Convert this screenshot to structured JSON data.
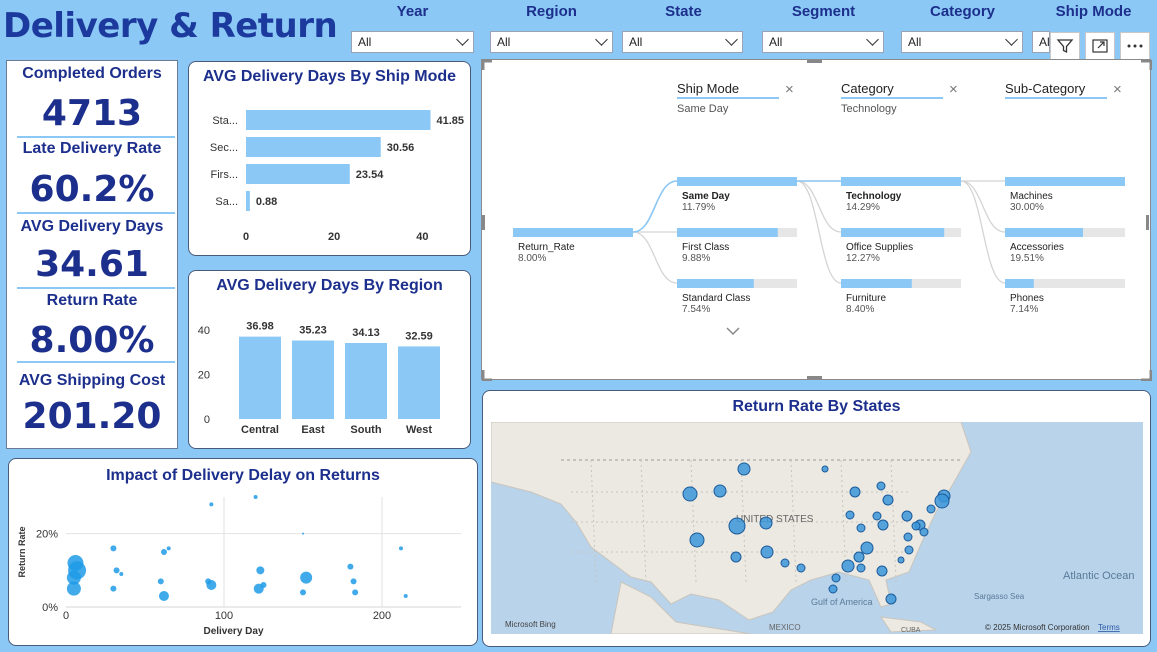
{
  "header": {
    "title": "Delivery & Return"
  },
  "slicers": [
    {
      "label": "Year",
      "value": "All"
    },
    {
      "label": "Region",
      "value": "All"
    },
    {
      "label": "State",
      "value": "All"
    },
    {
      "label": "Segment",
      "value": "All"
    },
    {
      "label": "Category",
      "value": "All"
    },
    {
      "label": "Ship Mode",
      "value": "All"
    }
  ],
  "kpis": [
    {
      "label": "Completed Orders",
      "value": "4713"
    },
    {
      "label": "Late Delivery Rate",
      "value": "60.2%"
    },
    {
      "label": "AVG Delivery Days",
      "value": "34.61"
    },
    {
      "label": "Return Rate",
      "value": "8.00%"
    },
    {
      "label": "AVG Shipping Cost",
      "value": "201.20"
    }
  ],
  "ship_mode_chart": {
    "title": "AVG Delivery Days By Ship Mode",
    "chart_data": {
      "type": "bar",
      "orientation": "horizontal",
      "categories": [
        "Sta...",
        "Sec...",
        "Firs...",
        "Sa..."
      ],
      "values": [
        41.85,
        30.56,
        23.54,
        0.88
      ],
      "value_labels": [
        "41.85",
        "30.56",
        "23.54",
        "0.88"
      ],
      "xticks": [
        "0",
        "20",
        "40"
      ],
      "xlim": [
        0,
        44
      ],
      "color": "#8cc8f5"
    }
  },
  "region_chart": {
    "title": "AVG Delivery Days By Region",
    "chart_data": {
      "type": "bar",
      "categories": [
        "Central",
        "East",
        "South",
        "West"
      ],
      "values": [
        36.98,
        35.23,
        34.13,
        32.59
      ],
      "value_labels": [
        "36.98",
        "35.23",
        "34.13",
        "32.59"
      ],
      "yticks": [
        "40",
        "20",
        "0"
      ],
      "ylim": [
        0,
        44
      ],
      "color": "#8cc8f5"
    }
  },
  "decomp_tree": {
    "levels": [
      {
        "header": "Ship Mode",
        "filter": "Same Day",
        "close": "×"
      },
      {
        "header": "Category",
        "filter": "Technology",
        "close": "×"
      },
      {
        "header": "Sub-Category",
        "filter": "",
        "close": "×"
      }
    ],
    "root": {
      "name": "Return_Rate",
      "value": "8.00%",
      "fraction": 1.0
    },
    "col1": [
      {
        "name": "Same Day",
        "value": "11.79%",
        "fraction": 1.0,
        "bold": true
      },
      {
        "name": "First Class",
        "value": "9.88%",
        "fraction": 0.84
      },
      {
        "name": "Standard Class",
        "value": "7.54%",
        "fraction": 0.64
      }
    ],
    "col2": [
      {
        "name": "Technology",
        "value": "14.29%",
        "fraction": 1.0,
        "bold": true
      },
      {
        "name": "Office Supplies",
        "value": "12.27%",
        "fraction": 0.86
      },
      {
        "name": "Furniture",
        "value": "8.40%",
        "fraction": 0.59
      }
    ],
    "col3": [
      {
        "name": "Machines",
        "value": "30.00%",
        "fraction": 1.0
      },
      {
        "name": "Accessories",
        "value": "19.51%",
        "fraction": 0.65
      },
      {
        "name": "Phones",
        "value": "7.14%",
        "fraction": 0.24
      }
    ],
    "more_icon": "chevron-down-icon"
  },
  "map": {
    "title": "Return Rate By States",
    "label_country": "UNITED STATES",
    "label_gulf": "Gulf of America",
    "label_ocean": "Atlantic Ocean",
    "label_sargasso": "Sargasso Sea",
    "label_mexico": "MEXICO",
    "label_cuba": "CUBA",
    "brand": "Microsoft Bing",
    "copyright": "© 2025 Microsoft Corporation",
    "terms": "Terms"
  },
  "scatter_chart": {
    "title": "Impact of Delivery Delay on Returns",
    "chart_data": {
      "type": "scatter",
      "xlabel": "Delivery Day",
      "ylabel": "Return Rate",
      "xticks": [
        "0",
        "100",
        "200"
      ],
      "yticks": [
        "0%",
        "20%"
      ],
      "xlim": [
        0,
        250
      ],
      "ylim": [
        0,
        0.3
      ],
      "points": [
        {
          "x": 5,
          "y": 0.08,
          "r": 7
        },
        {
          "x": 6,
          "y": 0.12,
          "r": 8
        },
        {
          "x": 5,
          "y": 0.05,
          "r": 7
        },
        {
          "x": 7,
          "y": 0.1,
          "r": 9
        },
        {
          "x": 30,
          "y": 0.16,
          "r": 3
        },
        {
          "x": 32,
          "y": 0.1,
          "r": 3
        },
        {
          "x": 30,
          "y": 0.05,
          "r": 3
        },
        {
          "x": 35,
          "y": 0.09,
          "r": 2
        },
        {
          "x": 62,
          "y": 0.15,
          "r": 3
        },
        {
          "x": 65,
          "y": 0.16,
          "r": 2
        },
        {
          "x": 60,
          "y": 0.07,
          "r": 3
        },
        {
          "x": 62,
          "y": 0.03,
          "r": 5
        },
        {
          "x": 92,
          "y": 0.28,
          "r": 2
        },
        {
          "x": 92,
          "y": 0.06,
          "r": 5
        },
        {
          "x": 90,
          "y": 0.07,
          "r": 3
        },
        {
          "x": 120,
          "y": 0.3,
          "r": 2
        },
        {
          "x": 123,
          "y": 0.1,
          "r": 4
        },
        {
          "x": 122,
          "y": 0.05,
          "r": 5
        },
        {
          "x": 125,
          "y": 0.06,
          "r": 3
        },
        {
          "x": 150,
          "y": 0.2,
          "r": 1
        },
        {
          "x": 152,
          "y": 0.08,
          "r": 6
        },
        {
          "x": 150,
          "y": 0.04,
          "r": 3
        },
        {
          "x": 180,
          "y": 0.11,
          "r": 3
        },
        {
          "x": 182,
          "y": 0.07,
          "r": 3
        },
        {
          "x": 183,
          "y": 0.04,
          "r": 3
        },
        {
          "x": 212,
          "y": 0.16,
          "r": 2
        },
        {
          "x": 215,
          "y": 0.03,
          "r": 2
        }
      ]
    }
  }
}
